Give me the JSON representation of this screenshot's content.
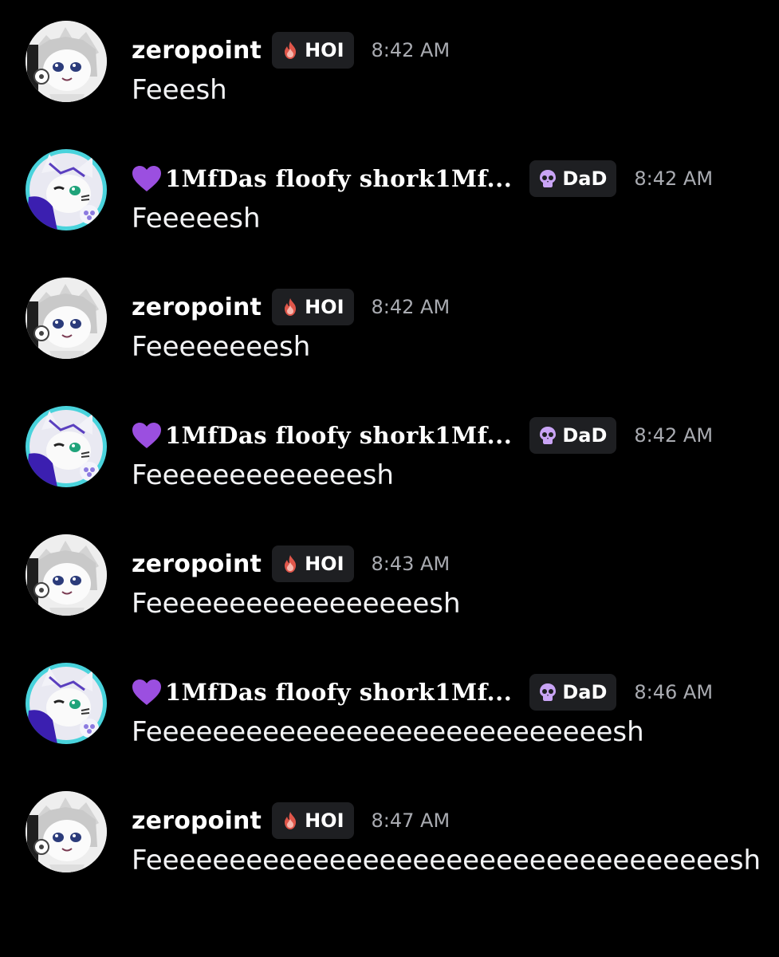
{
  "messages": [
    {
      "author": "zeropoint",
      "tag": "HOI",
      "tag_icon": "fire-icon",
      "time": "8:42 AM",
      "text": "Feeesh"
    },
    {
      "author": "1MfDas floofy shork1Mf...",
      "author_prefix_icon": "purple-heart-icon",
      "tag": "DaD",
      "tag_icon": "skull-icon",
      "time": "8:42 AM",
      "text": "Feeeeesh"
    },
    {
      "author": "zeropoint",
      "tag": "HOI",
      "tag_icon": "fire-icon",
      "time": "8:42 AM",
      "text": "Feeeeeeeesh"
    },
    {
      "author": "1MfDas floofy shork1Mf...",
      "author_prefix_icon": "purple-heart-icon",
      "tag": "DaD",
      "tag_icon": "skull-icon",
      "time": "8:42 AM",
      "text": "Feeeeeeeeeeeeesh"
    },
    {
      "author": "zeropoint",
      "tag": "HOI",
      "tag_icon": "fire-icon",
      "time": "8:43 AM",
      "text": "Feeeeeeeeeeeeeeeeesh"
    },
    {
      "author": "1MfDas floofy shork1Mf...",
      "author_prefix_icon": "purple-heart-icon",
      "tag": "DaD",
      "tag_icon": "skull-icon",
      "time": "8:46 AM",
      "text": "Feeeeeeeeeeeeeeeeeeeeeeeeeeeesh"
    },
    {
      "author": "zeropoint",
      "tag": "HOI",
      "tag_icon": "fire-icon",
      "time": "8:47 AM",
      "text": "Feeeeeeeeeeeeeeeeeeeeeeeeeeeeeeeeeeesh"
    }
  ],
  "colors": {
    "background": "#000000",
    "message_text": "#f2f3f5",
    "timestamp": "#a9abb1",
    "tag_background": "#1e1f22",
    "heart": "#9b4fe0",
    "skull": "#c9a4f5"
  }
}
